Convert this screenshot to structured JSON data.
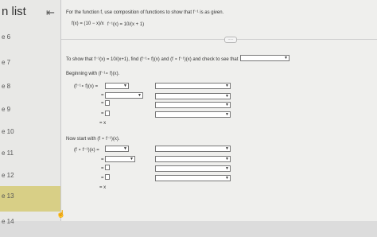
{
  "sidebar": {
    "title": "n list",
    "collapse_icon": "collapse-left-icon",
    "items": [
      {
        "label": "e 6"
      },
      {
        "label": "e 7"
      },
      {
        "label": "e 8"
      },
      {
        "label": "e 9"
      },
      {
        "label": "e 10"
      },
      {
        "label": "e 11"
      },
      {
        "label": "e 12"
      },
      {
        "label": "e 13",
        "active": true
      },
      {
        "label": "e 14"
      }
    ],
    "active_color": "#d8cf86"
  },
  "question": {
    "prompt": "For the function f, use composition of functions to show that f⁻¹ is as given.",
    "given_f": "f(x) = (10 − x)/x",
    "given_finv": "f⁻¹(x) = 10/(x + 1)",
    "show_that": "To show that f⁻¹(x) = 10/(x+1), find (f⁻¹∘ f)(x) and (f ∘ f⁻¹)(x) and check to see that",
    "part1_intro": "Beginning with (f⁻¹∘ f)(x).",
    "part1_lhs": "(f⁻¹∘ f)(x) =",
    "part2_intro": "Now start with (f ∘ f⁻¹)(x).",
    "part2_lhs": "(f ∘ f⁻¹)(x) =",
    "eq": "=",
    "eq_x": "= x",
    "divider_dots": "....."
  }
}
